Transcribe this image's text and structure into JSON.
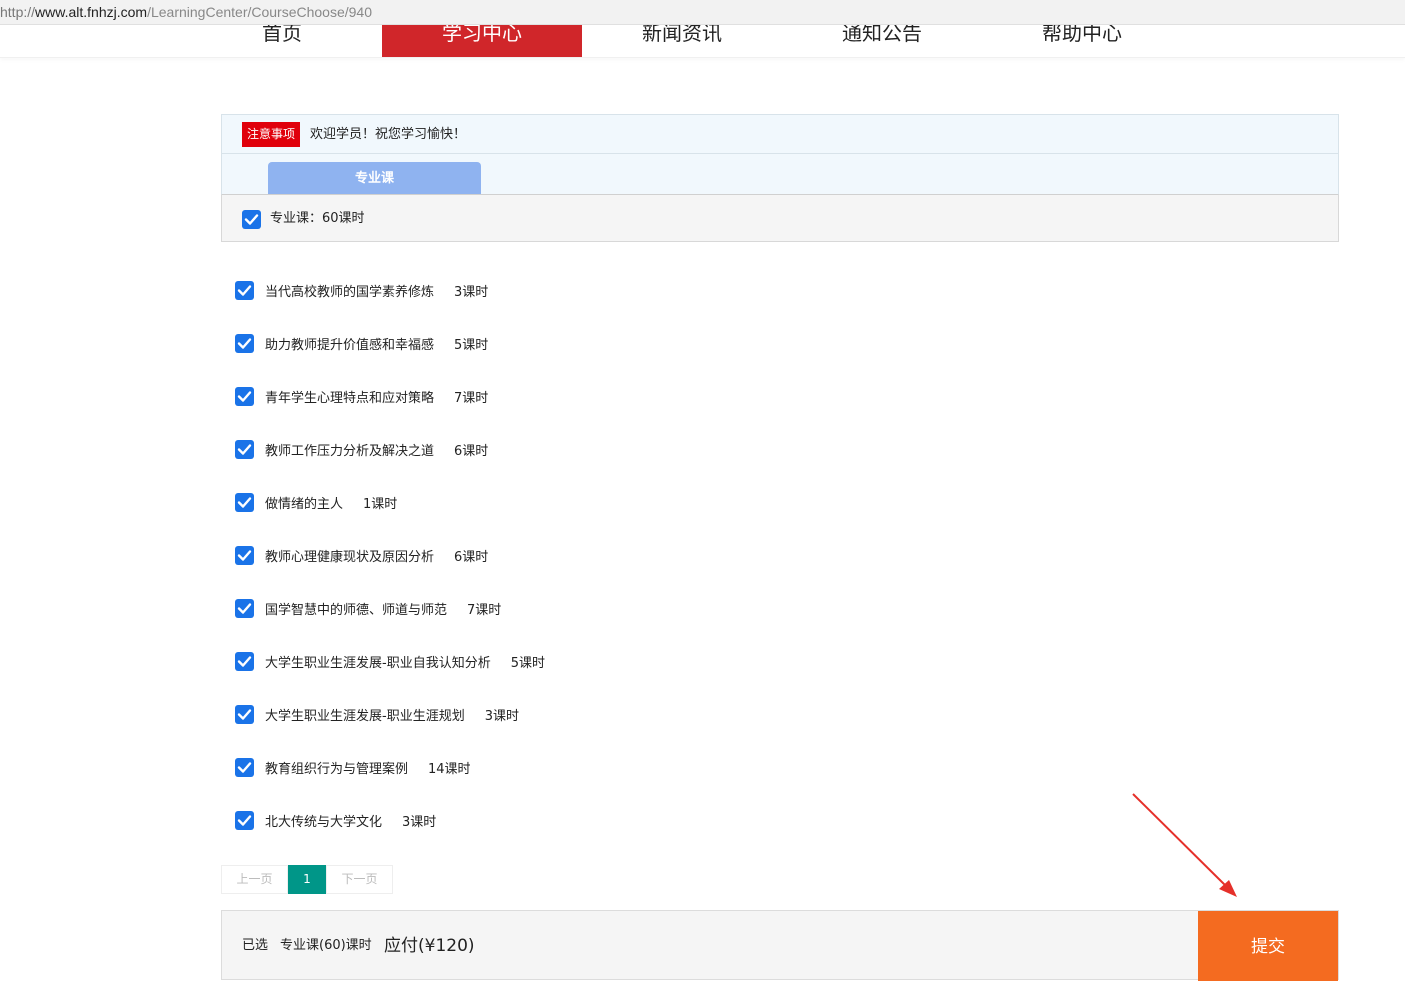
{
  "url": {
    "scheme": "http://",
    "host": "www.alt.fnhzj.com",
    "path": "/LearningCenter/CourseChoose/940"
  },
  "nav": [
    {
      "label": "首页",
      "active": false
    },
    {
      "label": "学习中心",
      "active": true
    },
    {
      "label": "新闻资讯",
      "active": false
    },
    {
      "label": "通知公告",
      "active": false
    },
    {
      "label": "帮助中心",
      "active": false
    }
  ],
  "notice": {
    "badge": "注意事项",
    "text": "欢迎学员！祝您学习愉快！"
  },
  "tabs": [
    {
      "label": "专业课",
      "active": true
    }
  ],
  "summary": {
    "label": "专业课：60课时",
    "checked": true
  },
  "courses": [
    {
      "name": "当代高校教师的国学素养修炼",
      "hours": "3课时",
      "checked": true
    },
    {
      "name": "助力教师提升价值感和幸福感",
      "hours": "5课时",
      "checked": true
    },
    {
      "name": "青年学生心理特点和应对策略",
      "hours": "7课时",
      "checked": true
    },
    {
      "name": "教师工作压力分析及解决之道",
      "hours": "6课时",
      "checked": true
    },
    {
      "name": "做情绪的主人",
      "hours": "1课时",
      "checked": true
    },
    {
      "name": "教师心理健康现状及原因分析",
      "hours": "6课时",
      "checked": true
    },
    {
      "name": "国学智慧中的师德、师道与师范",
      "hours": "7课时",
      "checked": true
    },
    {
      "name": "大学生职业生涯发展-职业自我认知分析",
      "hours": "5课时",
      "checked": true
    },
    {
      "name": "大学生职业生涯发展-职业生涯规划",
      "hours": "3课时",
      "checked": true
    },
    {
      "name": "教育组织行为与管理案例",
      "hours": "14课时",
      "checked": true
    },
    {
      "name": "北大传统与大学文化",
      "hours": "3课时",
      "checked": true
    }
  ],
  "pager": {
    "prev": "上一页",
    "current": "1",
    "next": "下一页"
  },
  "bottom": {
    "selected_label": "已选",
    "course_summary": "专业课(60)课时",
    "pay_text": "应付(¥120)",
    "submit_label": "提交"
  },
  "colors": {
    "nav_active": "#d0262a",
    "notice_badge": "#e0000b",
    "tab": "#8fb3f0",
    "checkbox": "#1a73e8",
    "pager_current": "#009688",
    "submit": "#f46b20",
    "annotation_arrow": "#e5302a"
  }
}
